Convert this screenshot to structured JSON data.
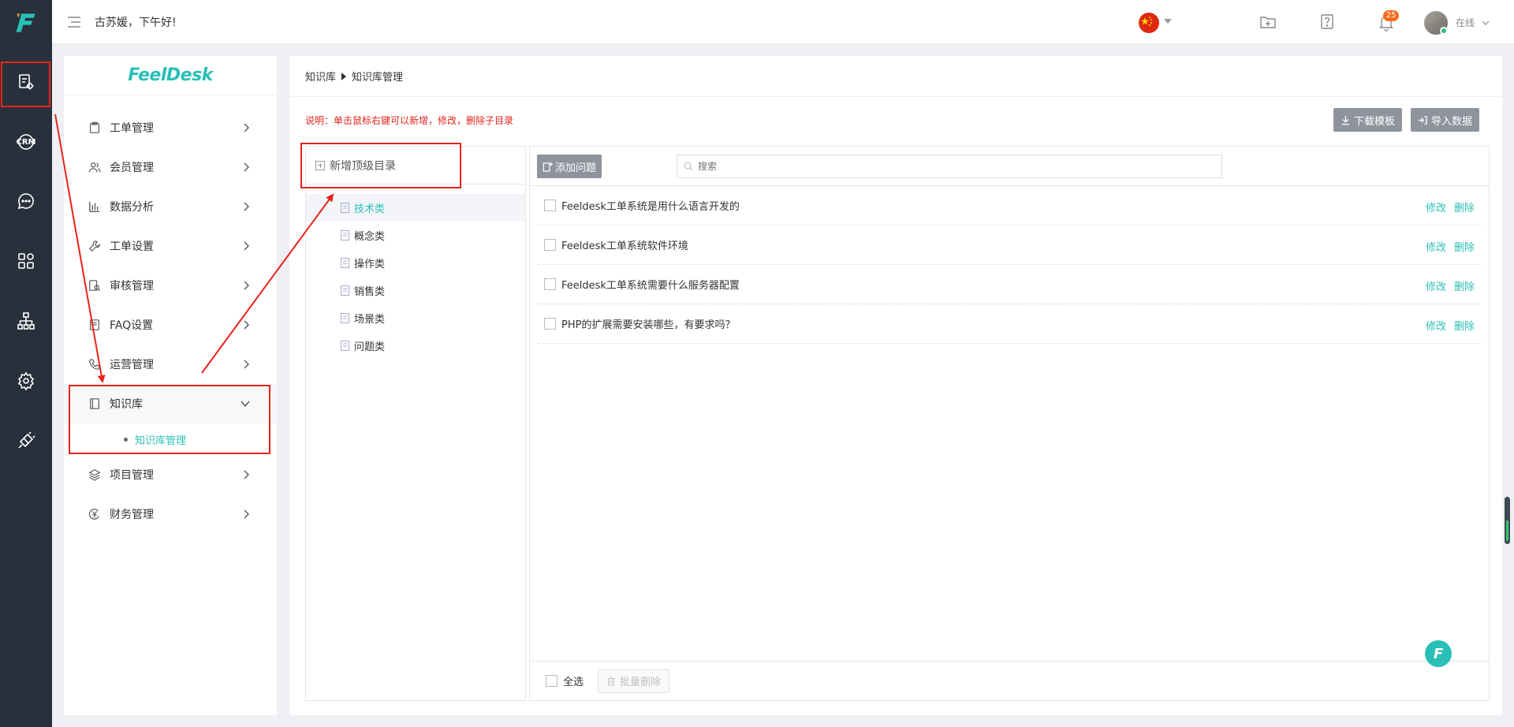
{
  "app": {
    "greeting": "古苏媛，下午好!",
    "logo_letter": "F",
    "brand_name": "FeelDesk",
    "accent": "#2abfb6",
    "rail_color": "#27303b",
    "warning_color": "#e0241c"
  },
  "rail": {
    "icons": [
      "ticket-settings-icon",
      "crm-icon",
      "chat-icon",
      "apps-grid-icon",
      "org-chart-icon",
      "gear-icon",
      "plugin-icon"
    ],
    "crm_label": "CRM"
  },
  "header": {
    "notification_count": "25",
    "status": "在线",
    "language": "中文"
  },
  "sidebar": {
    "items": [
      {
        "label": "工单管理",
        "icon": "clipboard-icon"
      },
      {
        "label": "会员管理",
        "icon": "users-icon"
      },
      {
        "label": "数据分析",
        "icon": "bar-chart-icon"
      },
      {
        "label": "工单设置",
        "icon": "wrench-icon"
      },
      {
        "label": "审核管理",
        "icon": "review-icon"
      },
      {
        "label": "FAQ设置",
        "icon": "faq-icon"
      },
      {
        "label": "运营管理",
        "icon": "phone-icon"
      },
      {
        "label": "知识库",
        "icon": "book-icon"
      },
      {
        "label": "项目管理",
        "icon": "layers-icon"
      },
      {
        "label": "财务管理",
        "icon": "yen-icon"
      }
    ],
    "submenu": {
      "label": "知识库管理"
    }
  },
  "main": {
    "breadcrumb": [
      "知识库",
      "知识库管理"
    ],
    "note": "说明：单击鼠标右键可以新增，修改，删除子目录",
    "download_template": "下载模板",
    "import_data": "导入数据"
  },
  "tree": {
    "add_top": "新增顶级目录",
    "nodes": [
      "技术类",
      "概念类",
      "操作类",
      "销售类",
      "场景类",
      "问题类"
    ],
    "active_index": 0
  },
  "questions": {
    "add_button": "添加问题",
    "search_placeholder": "搜索",
    "edit_label": "修改",
    "delete_label": "删除",
    "items": [
      "Feeldesk工单系统是用什么语言开发的",
      "Feeldesk工单系统软件环境",
      "Feeldesk工单系统需要什么服务器配置",
      "PHP的扩展需要安装哪些，有要求吗？"
    ],
    "select_all": "全选",
    "batch_delete": "批量删除"
  }
}
